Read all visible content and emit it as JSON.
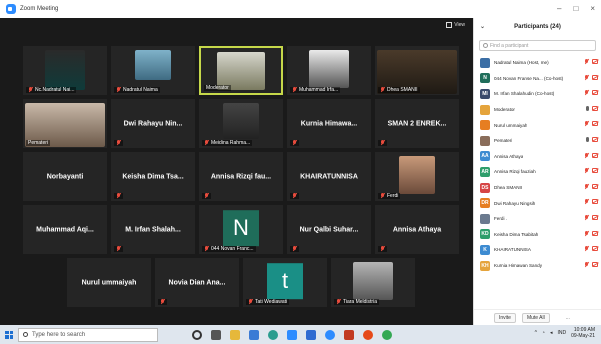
{
  "window": {
    "title": "Zoom Meeting",
    "minimize": "–",
    "maximize": "□",
    "close": "×"
  },
  "view_button": {
    "label": "View"
  },
  "tiles": [
    {
      "label": "Nc.Nadratul Nai...",
      "muted": true
    },
    {
      "label": "Nadratul Naima",
      "muted": true
    },
    {
      "label": "Moderator",
      "muted": false
    },
    {
      "label": "Muhammad Irfa...",
      "muted": true
    },
    {
      "label": "Dhea SMANII",
      "muted": true
    },
    {
      "label": "Pemateri",
      "muted": false
    },
    {
      "name": "Dwi Rahayu Nin...",
      "muted": true
    },
    {
      "label": "Meidina Rahma...",
      "muted": true
    },
    {
      "name": "Kurnia Himawa...",
      "muted": true
    },
    {
      "name": "SMAN 2 ENREK...",
      "muted": true
    },
    {
      "name": "Norbayanti",
      "muted": false
    },
    {
      "name": "Keisha Dima Tsa...",
      "muted": true
    },
    {
      "name": "Annisa Rizqi fau...",
      "muted": true
    },
    {
      "name": "KHAIRATUNNISA",
      "muted": true
    },
    {
      "label": "Ferdi",
      "muted": true
    },
    {
      "name": "Muhammad Aqi...",
      "muted": false
    },
    {
      "name": "M. Irfan Shalah...",
      "muted": true
    },
    {
      "avatar": "N",
      "label": "044 Novan Franc...",
      "muted": true
    },
    {
      "name": "Nur Qalbi Suhar...",
      "muted": true
    },
    {
      "name": "Annisa Athaya",
      "muted": true
    },
    {
      "name": "Nurul ummaiyah",
      "muted": false
    },
    {
      "name": "Novia Dian Ana...",
      "muted": true
    },
    {
      "avatar": "t",
      "label": "Tati Wediawati",
      "muted": true
    },
    {
      "label": "Tiara Meldistria",
      "muted": true
    }
  ],
  "participants_panel": {
    "title": "Participants (24)",
    "search_placeholder": "Find a participant",
    "rows": [
      {
        "name": "Nadratul Naima (Host, me)",
        "avatar": "",
        "color": "#3b6ea5"
      },
      {
        "name": "044 Novan Franse Na... (Co-host)",
        "avatar": "N",
        "color": "#1f6d5a"
      },
      {
        "name": "M. Irfan Shalahudin (Co-host)",
        "avatar": "MI",
        "color": "#3a4a6b"
      },
      {
        "name": "Moderator",
        "avatar": "",
        "color": "#e5a43c"
      },
      {
        "name": "Nurul ummaiyah",
        "avatar": "",
        "color": "#e67e22"
      },
      {
        "name": "Pemateri",
        "avatar": "",
        "color": "#8a6d5a"
      },
      {
        "name": "Annisa Athaya",
        "avatar": "AA",
        "color": "#3d8bd1"
      },
      {
        "name": "Annisa Rizqi fauziah",
        "avatar": "AR",
        "color": "#2e9e6b"
      },
      {
        "name": "Dhea SMANII",
        "avatar": "DS",
        "color": "#d64545"
      },
      {
        "name": "Dwi Rahayu Ningsih",
        "avatar": "DR",
        "color": "#e67e22"
      },
      {
        "name": "Ferdi .",
        "avatar": "",
        "color": "#6b7a8f"
      },
      {
        "name": "Keisha Dima Tsabitah",
        "avatar": "KD",
        "color": "#2e9e6b"
      },
      {
        "name": "KHAIRATUNNISA",
        "avatar": "K",
        "color": "#3d8bd1"
      },
      {
        "name": "Kurnia Himawan Sandy",
        "avatar": "KH",
        "color": "#e5a43c"
      }
    ],
    "invite_label": "Invite",
    "mute_all_label": "Mute All",
    "more_label": "..."
  },
  "taskbar": {
    "search_placeholder": "Type here to search",
    "lang": "IND",
    "time": "10:09 AM",
    "date": "09-May-21"
  }
}
